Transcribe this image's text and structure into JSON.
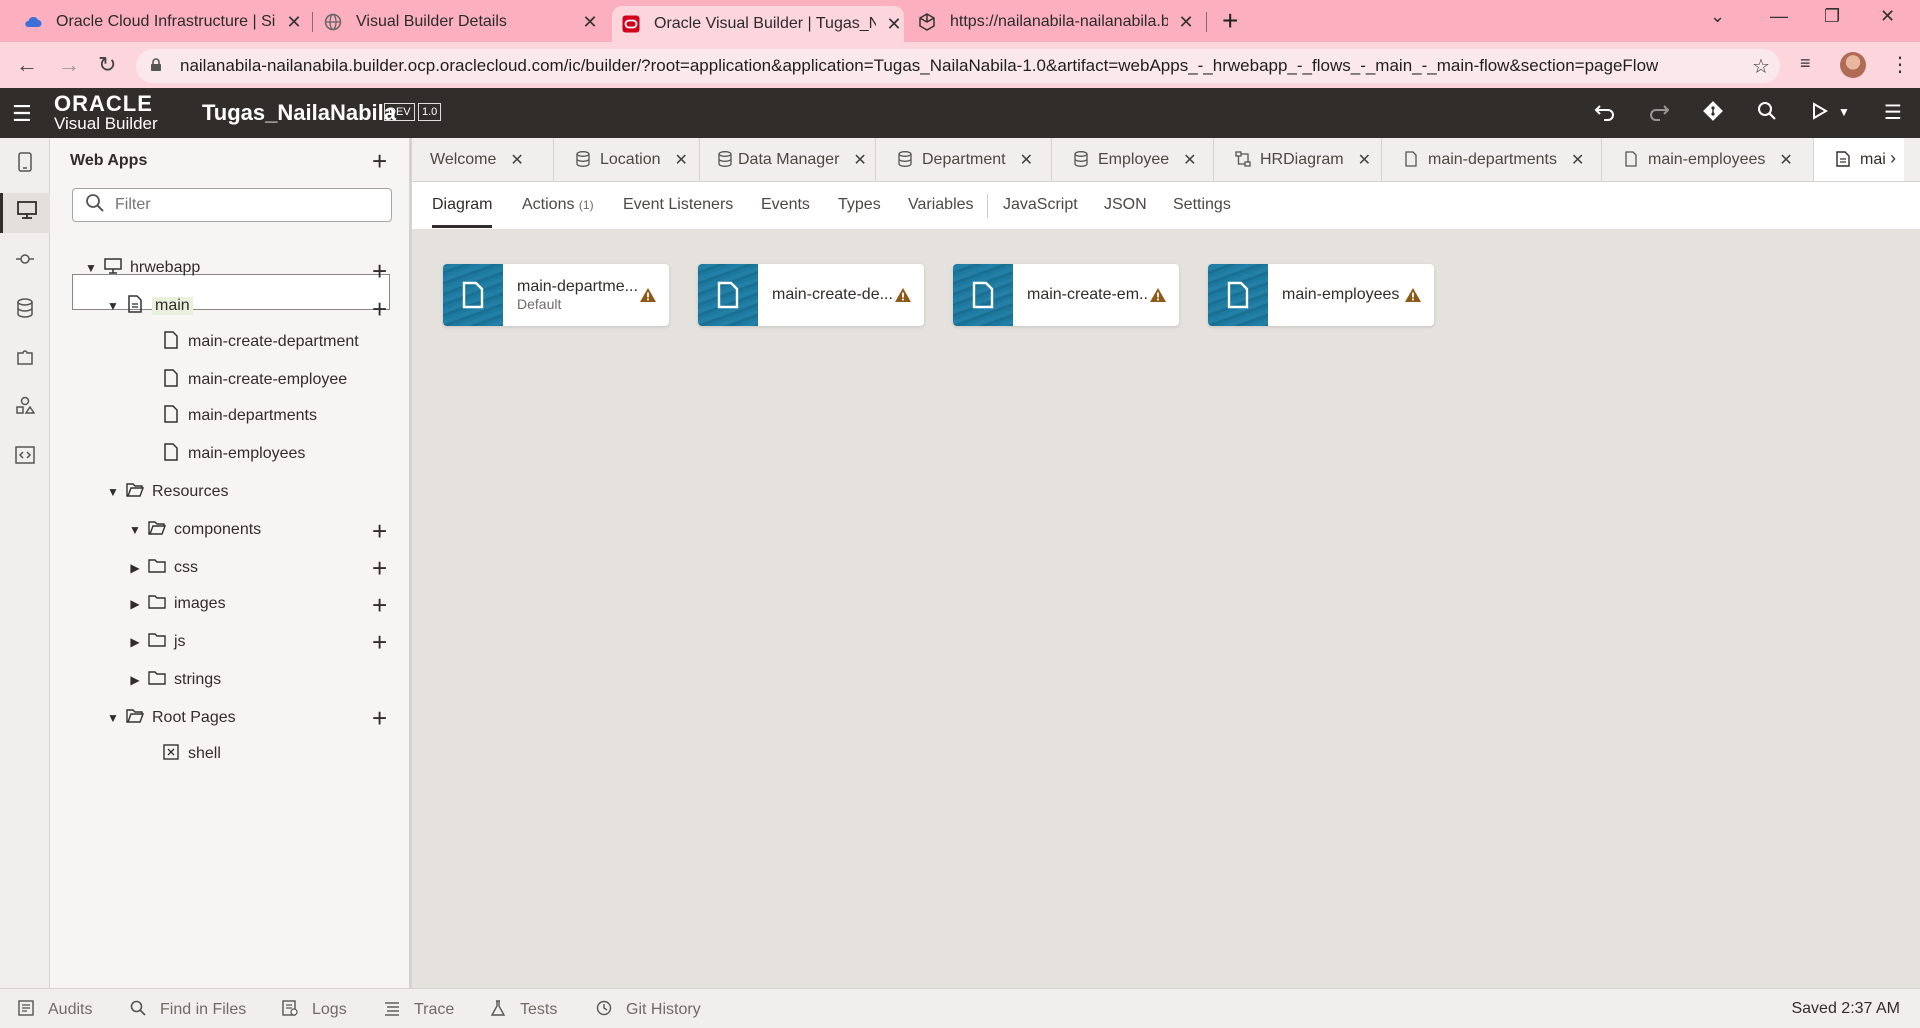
{
  "browser": {
    "tabs": [
      {
        "title": "Oracle Cloud Infrastructure | Sign",
        "icon": "cloud-icon"
      },
      {
        "title": "Visual Builder Details",
        "icon": "globe-icon"
      },
      {
        "title": "Oracle Visual Builder | Tugas_Nai",
        "icon": "oracle-icon"
      },
      {
        "title": "https://nailanabila-nailanabila.bu",
        "icon": "cube-icon"
      }
    ],
    "url": "nailanabila-nailanabila.builder.ocp.oraclecloud.com/ic/builder/?root=application&application=Tugas_NailaNabila-1.0&artifact=webApps_-_hrwebapp_-_flows_-_main_-_main-flow&section=pageFlow"
  },
  "header": {
    "brand_line1": "ORACLE",
    "brand_line2": "Visual Builder",
    "app_name": "Tugas_NailaNabila",
    "badge_env": "DEV",
    "badge_version": "1.0"
  },
  "navigator": {
    "title": "Web Apps",
    "filter_placeholder": "Filter",
    "nodes": {
      "hrwebapp": "hrwebapp",
      "main": "main",
      "main_create_department": "main-create-department",
      "main_create_employee": "main-create-employee",
      "main_departments": "main-departments",
      "main_employees": "main-employees",
      "resources": "Resources",
      "components": "components",
      "css": "css",
      "images": "images",
      "js": "js",
      "strings": "strings",
      "root_pages": "Root Pages",
      "shell": "shell"
    }
  },
  "editor_tabs": [
    {
      "label": "Welcome",
      "icon": ""
    },
    {
      "label": "Location",
      "icon": "database-icon"
    },
    {
      "label": "Data Manager",
      "icon": "database-icon"
    },
    {
      "label": "Department",
      "icon": "database-icon"
    },
    {
      "label": "Employee",
      "icon": "database-icon"
    },
    {
      "label": "HRDiagram",
      "icon": "diagram-icon"
    },
    {
      "label": "main-departments",
      "icon": "page-icon"
    },
    {
      "label": "main-employees",
      "icon": "page-icon"
    },
    {
      "label": "mai",
      "icon": "flow-icon"
    }
  ],
  "sub_tabs": {
    "diagram": "Diagram",
    "actions": "Actions",
    "actions_count": "(1)",
    "event_listeners": "Event Listeners",
    "events": "Events",
    "types": "Types",
    "variables": "Variables",
    "javascript": "JavaScript",
    "json": "JSON",
    "settings": "Settings"
  },
  "diagram_cards": [
    {
      "name": "main-departme...",
      "sub": "Default"
    },
    {
      "name": "main-create-de...",
      "sub": ""
    },
    {
      "name": "main-create-em...",
      "sub": ""
    },
    {
      "name": "main-employees",
      "sub": ""
    }
  ],
  "footer": {
    "audits": "Audits",
    "find_in_files": "Find in Files",
    "logs": "Logs",
    "trace": "Trace",
    "tests": "Tests",
    "git_history": "Git History",
    "saved": "Saved 2:37 AM"
  },
  "colors": {
    "browser_tab_bar": "#fbafbf",
    "address_bar": "#fdd5dd",
    "app_header": "#312d2a",
    "card_accent": "#1c7aa0",
    "warning": "#8a5a16"
  }
}
